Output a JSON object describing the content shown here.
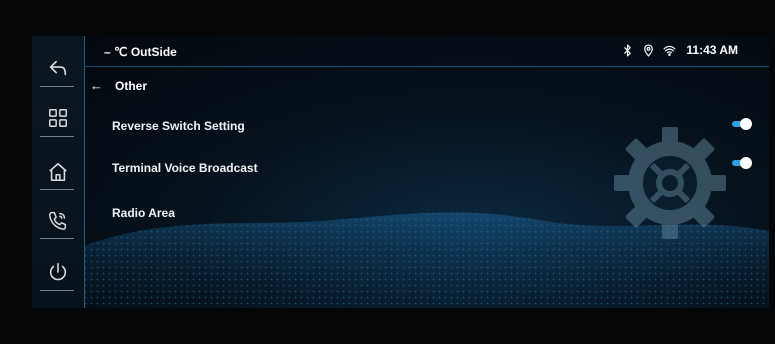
{
  "status_bar": {
    "outside_temp": "– ℃ OutSide",
    "time": "11:43 AM",
    "icons": [
      "bluetooth-icon",
      "location-icon",
      "wifi-icon"
    ]
  },
  "sidebar": {
    "items": [
      {
        "name": "back",
        "icon": "back-arrow-icon"
      },
      {
        "name": "apps",
        "icon": "grid-icon"
      },
      {
        "name": "home",
        "icon": "home-icon"
      },
      {
        "name": "phone",
        "icon": "phone-icon"
      },
      {
        "name": "power",
        "icon": "power-icon"
      }
    ]
  },
  "section": {
    "back_glyph": "←",
    "title": "Other"
  },
  "settings": [
    {
      "label": "Reverse Switch Setting",
      "toggle": true
    },
    {
      "label": "Terminal Voice Broadcast",
      "toggle": true
    },
    {
      "label": "Radio Area",
      "toggle": null
    }
  ],
  "colors": {
    "accent": "#2f9fe6",
    "background": "#03070c",
    "sidebar_border": "#1b5f86"
  }
}
